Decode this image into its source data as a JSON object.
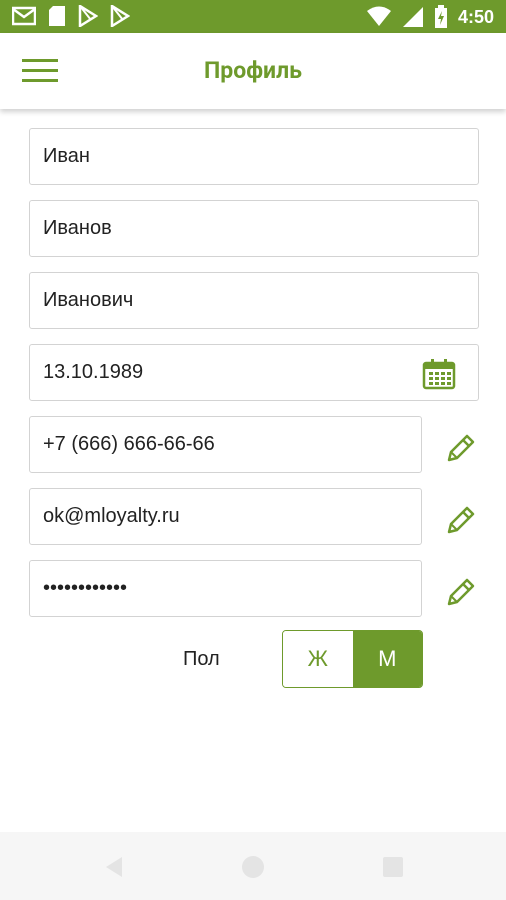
{
  "status_bar": {
    "time": "4:50",
    "left_icons": [
      "gmail-icon",
      "sd-card-icon",
      "play-store-icon",
      "play-store-icon"
    ],
    "right_icons": [
      "wifi-icon",
      "cellular-signal-icon",
      "battery-charging-icon"
    ]
  },
  "app_bar": {
    "title": "Профиль",
    "menu_icon": "hamburger-menu-icon"
  },
  "form": {
    "first_name": "Иван",
    "last_name": "Иванов",
    "middle_name": "Иванович",
    "birth_date": "13.10.1989",
    "phone": "+7 (666) 666-66-66",
    "email": "ok@mloyalty.ru",
    "password": "••••••••••••"
  },
  "gender": {
    "label": "Пол",
    "female_label": "Ж",
    "male_label": "М",
    "selected": "М"
  },
  "colors": {
    "accent": "#6e9a2c",
    "border": "#d3d3d3",
    "text": "#222222",
    "nav_bar": "#f6f6f6"
  }
}
